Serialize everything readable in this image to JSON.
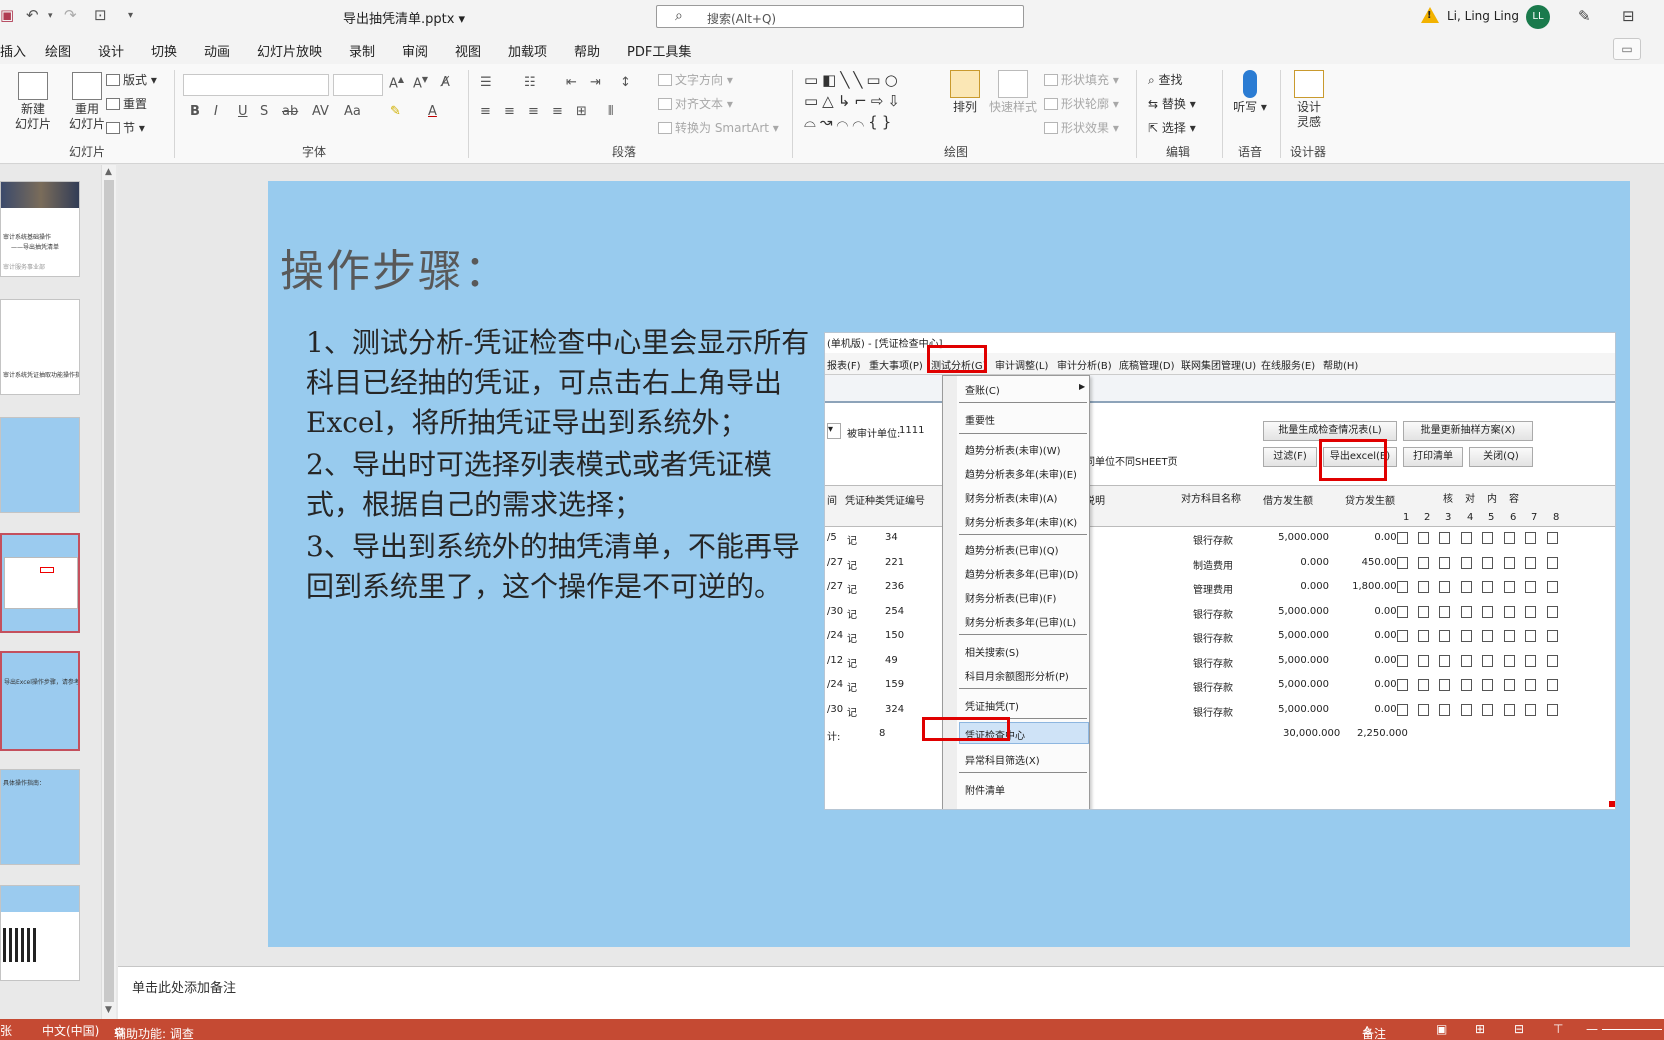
{
  "titlebar": {
    "doc_title": "导出抽凭清单.pptx ▾",
    "search_placeholder": "搜索(Alt+Q)",
    "user_name": "Li, Ling Ling",
    "avatar_initials": "LL"
  },
  "tabs": [
    "插入",
    "绘图",
    "设计",
    "切换",
    "动画",
    "幻灯片放映",
    "录制",
    "审阅",
    "视图",
    "加载项",
    "帮助",
    "PDF工具集"
  ],
  "ribbon": {
    "slides": {
      "new_slide": "新建\n幻灯片",
      "reuse_slide": "重用\n幻灯片",
      "layout": "版式",
      "reset": "重置",
      "section": "节",
      "label": "幻灯片"
    },
    "font": {
      "label": "字体"
    },
    "paragraph": {
      "text_direction": "文字方向",
      "align_text": "对齐文本",
      "convert_smartart": "转换为 SmartArt",
      "label": "段落"
    },
    "drawing": {
      "arrange": "排列",
      "quick_styles": "快速样式",
      "shape_fill": "形状填充",
      "shape_outline": "形状轮廓",
      "shape_effects": "形状效果",
      "label": "绘图"
    },
    "editing": {
      "find": "查找",
      "replace": "替换",
      "select": "选择",
      "label": "编辑"
    },
    "voice": {
      "dictate": "听写",
      "label": "语音"
    },
    "designer": {
      "design_ideas": "设计\n灵感",
      "label": "设计器"
    }
  },
  "thumbnails": {
    "t1_line1": "审计系统基础操作",
    "t1_line2": "——导出抽凭清单",
    "t1_line3": "审计服务事业部",
    "t2_text": "审计系统凭证抽取功能操作指南",
    "t5_text": "导出Excel操作步骤，请参考",
    "t6_text": "具体操作指南："
  },
  "slide": {
    "title": "操作步骤：",
    "paragraphs": [
      "1、测试分析-凭证检查中心里会显示所有科目已经抽的凭证，可点击右上角导出Excel，将所抽凭证导出到系统外；",
      "2、导出时可选择列表模式或者凭证模式，根据自己的需求选择；",
      "3、导出到系统外的抽凭清单，不能再导回到系统里了，这个操作是不可逆的。"
    ]
  },
  "embedded": {
    "window_title": "(单机版) - [凭证检查中心]",
    "menu": [
      "报表(F)",
      "重大事项(P)",
      "测试分析(G)",
      "审计调整(L)",
      "审计分析(B)",
      "底稿管理(D)",
      "联网集团管理(U)",
      "在线服务(E)",
      "帮助(H)"
    ],
    "audit_unit_label": "被审计单位:",
    "audit_unit_value": "1111",
    "right_label": "证",
    "sheet_note": "不同单位不同SHEET页",
    "buttons": {
      "batch_gen": "批量生成检查情况表(L)",
      "batch_update": "批量更新抽样方案(X)",
      "filter": "过滤(F)",
      "export_excel": "导出excel(E)",
      "print_list": "打印清单",
      "close": "关闭(Q)"
    },
    "headers": {
      "period": "间",
      "voucher_type": "凭证种类",
      "voucher_no": "凭证编号",
      "summary": "务说明",
      "counter_subject": "对方科目名称",
      "debit": "借方发生额",
      "credit": "贷方发生额",
      "check_groups": [
        "核",
        "对",
        "内",
        "容"
      ],
      "check_cols": [
        "1",
        "2",
        "3",
        "4",
        "5",
        "6",
        "7",
        "8"
      ]
    },
    "rows": [
      {
        "date": "/5",
        "type": "记",
        "no": "34",
        "subject": "银行存款",
        "debit": "5,000.000",
        "credit": "0.000"
      },
      {
        "date": "/27",
        "type": "记",
        "no": "221",
        "subject": "制造费用",
        "debit": "0.000",
        "credit": "450.000"
      },
      {
        "date": "/27",
        "type": "记",
        "no": "236",
        "subject": "管理费用",
        "debit": "0.000",
        "credit": "1,800.000"
      },
      {
        "date": "/30",
        "type": "记",
        "no": "254",
        "subject": "银行存款",
        "debit": "5,000.000",
        "credit": "0.000"
      },
      {
        "date": "/24",
        "type": "记",
        "no": "150",
        "subject": "银行存款",
        "debit": "5,000.000",
        "credit": "0.000"
      },
      {
        "date": "/12",
        "type": "记",
        "no": "49",
        "subject": "银行存款",
        "debit": "5,000.000",
        "credit": "0.000"
      },
      {
        "date": "/24",
        "type": "记",
        "no": "159",
        "subject": "银行存款",
        "debit": "5,000.000",
        "credit": "0.000"
      },
      {
        "date": "/30",
        "type": "记",
        "no": "324",
        "subject": "银行存款",
        "debit": "5,000.000",
        "credit": "0.000"
      }
    ],
    "total": {
      "label": "计:",
      "count": "8",
      "debit": "30,000.000",
      "credit": "2,250.000"
    },
    "dropdown": [
      "查账(C)",
      "重要性",
      "趋势分析表(未审)(W)",
      "趋势分析表多年(未审)(E)",
      "财务分析表(未审)(A)",
      "财务分析表多年(未审)(K)",
      "趋势分析表(已审)(Q)",
      "趋势分析表多年(已审)(D)",
      "财务分析表(已审)(F)",
      "财务分析表多年(已审)(L)",
      "相关搜索(S)",
      "科目月余额图形分析(P)",
      "凭证抽凭(T)",
      "凭证检查中心",
      "异常科目筛选(X)",
      "附件清单"
    ]
  },
  "notes_placeholder": "单击此处添加备注",
  "statusbar": {
    "left_fragment": "张",
    "language": "中文(中国)",
    "accessibility": "辅助功能: 调查",
    "notes": "备注"
  }
}
